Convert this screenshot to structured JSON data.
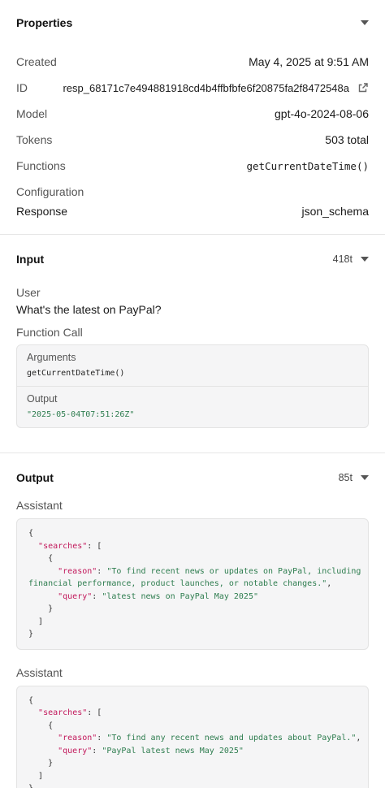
{
  "properties": {
    "title": "Properties",
    "created_label": "Created",
    "created_value": "May 4, 2025 at 9:51 AM",
    "id_label": "ID",
    "id_value": "resp_68171c7e494881918cd4b4ffbfbfe6f20875fa2f8472548a",
    "model_label": "Model",
    "model_value": "gpt-4o-2024-08-06",
    "tokens_label": "Tokens",
    "tokens_value": "503 total",
    "functions_label": "Functions",
    "functions_value": "getCurrentDateTime()",
    "configuration_label": "Configuration",
    "response_label": "Response",
    "response_value": "json_schema"
  },
  "input": {
    "title": "Input",
    "tokens": "418t",
    "user_label": "User",
    "user_text": "What's the latest on PayPal?",
    "function_call_label": "Function Call",
    "arguments_label": "Arguments",
    "arguments_value": "getCurrentDateTime()",
    "output_label": "Output",
    "output_value": "\"2025-05-04T07:51:26Z\""
  },
  "output": {
    "title": "Output",
    "tokens": "85t",
    "messages": [
      {
        "role": "Assistant",
        "lines": [
          [
            [
              "p",
              "{"
            ]
          ],
          [
            [
              "p",
              "  "
            ],
            [
              "k",
              "\"searches\""
            ],
            [
              "p",
              ": ["
            ]
          ],
          [
            [
              "p",
              "    {"
            ]
          ],
          [
            [
              "p",
              "      "
            ],
            [
              "k",
              "\"reason\""
            ],
            [
              "p",
              ": "
            ],
            [
              "s",
              "\"To find recent news or updates on PayPal, including"
            ]
          ],
          [
            [
              "s",
              "financial performance, product launches, or notable changes.\""
            ],
            [
              "p",
              ","
            ]
          ],
          [
            [
              "p",
              "      "
            ],
            [
              "k",
              "\"query\""
            ],
            [
              "p",
              ": "
            ],
            [
              "s",
              "\"latest news on PayPal May 2025\""
            ]
          ],
          [
            [
              "p",
              "    }"
            ]
          ],
          [
            [
              "p",
              "  ]"
            ]
          ],
          [
            [
              "p",
              "}"
            ]
          ]
        ]
      },
      {
        "role": "Assistant",
        "lines": [
          [
            [
              "p",
              "{"
            ]
          ],
          [
            [
              "p",
              "  "
            ],
            [
              "k",
              "\"searches\""
            ],
            [
              "p",
              ": ["
            ]
          ],
          [
            [
              "p",
              "    {"
            ]
          ],
          [
            [
              "p",
              "      "
            ],
            [
              "k",
              "\"reason\""
            ],
            [
              "p",
              ": "
            ],
            [
              "s",
              "\"To find any recent news and updates about PayPal.\""
            ],
            [
              "p",
              ","
            ]
          ],
          [
            [
              "p",
              "      "
            ],
            [
              "k",
              "\"query\""
            ],
            [
              "p",
              ": "
            ],
            [
              "s",
              "\"PayPal latest news May 2025\""
            ]
          ],
          [
            [
              "p",
              "    }"
            ]
          ],
          [
            [
              "p",
              "  ]"
            ]
          ],
          [
            [
              "p",
              "}"
            ]
          ]
        ]
      }
    ]
  },
  "colors": {
    "json_key": "#c2185b",
    "json_string": "#2e7d4f",
    "code_background": "#f5f5f6"
  },
  "icons": {
    "collapse": "caret-down-icon",
    "external_link": "external-link-icon"
  }
}
